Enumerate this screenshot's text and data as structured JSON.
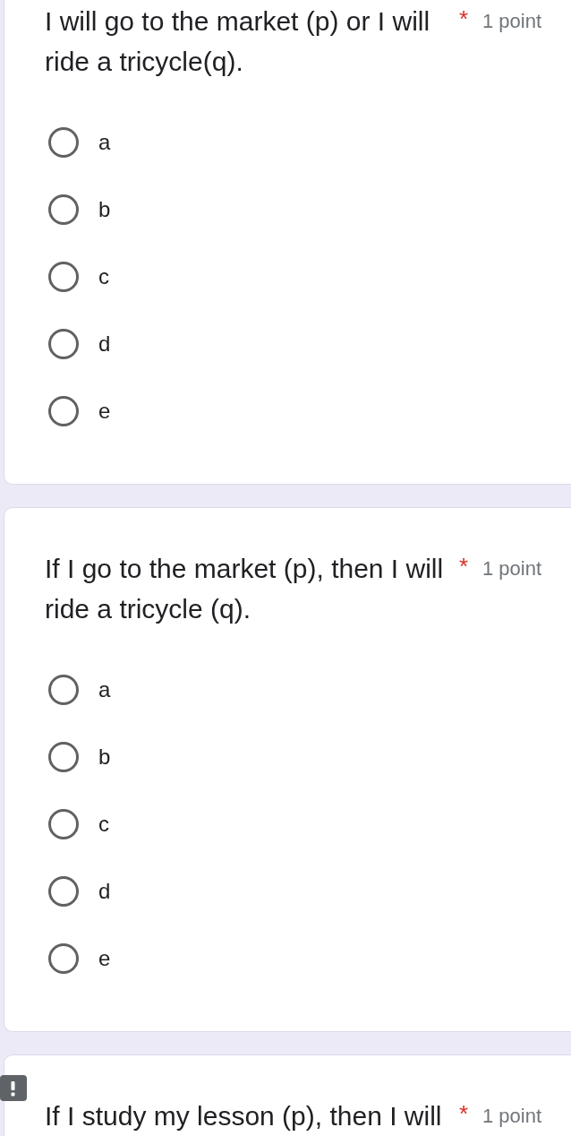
{
  "questions": [
    {
      "title": "I will go to the market (p) or I will ride a tricycle(q).",
      "required_mark": "*",
      "points": "1 point",
      "flagged": false,
      "options": [
        {
          "label": "a",
          "selected": false
        },
        {
          "label": "b",
          "selected": false
        },
        {
          "label": "c",
          "selected": false
        },
        {
          "label": "d",
          "selected": false
        },
        {
          "label": "e",
          "selected": false
        }
      ]
    },
    {
      "title": "If I go to the market (p), then I will ride a tricycle (q).",
      "required_mark": "*",
      "points": "1 point",
      "flagged": false,
      "options": [
        {
          "label": "a",
          "selected": false
        },
        {
          "label": "b",
          "selected": false
        },
        {
          "label": "c",
          "selected": false
        },
        {
          "label": "d",
          "selected": false
        },
        {
          "label": "e",
          "selected": false
        }
      ]
    },
    {
      "title": "If I study my lesson (p), then I will",
      "required_mark": "*",
      "points": "1 point",
      "flagged": true
    }
  ]
}
